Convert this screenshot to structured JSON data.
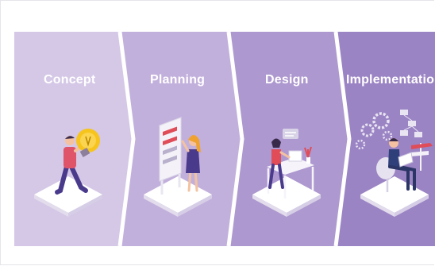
{
  "stages": [
    {
      "label": "Concept",
      "icon": "lightbulb-person-icon"
    },
    {
      "label": "Planning",
      "icon": "whiteboard-person-icon"
    },
    {
      "label": "Design",
      "icon": "desk-designer-icon"
    },
    {
      "label": "Implementation",
      "icon": "gears-developer-icon"
    }
  ],
  "colors": {
    "band1": "#d4c8e6",
    "band2": "#c2b0dc",
    "band3": "#ad98cf",
    "band4": "#9b84c4",
    "arrow": "#ffffff",
    "accent": "#e04c57"
  }
}
